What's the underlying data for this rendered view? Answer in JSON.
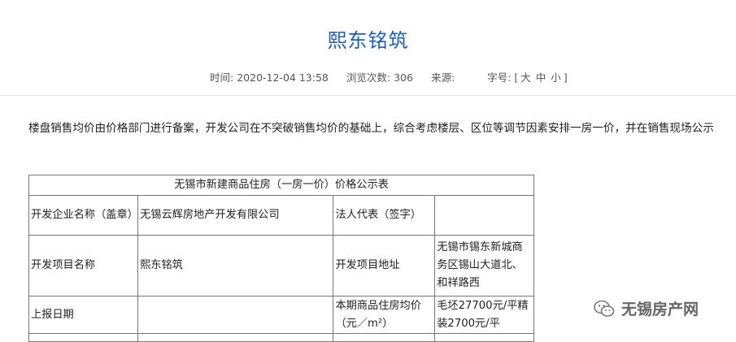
{
  "article": {
    "title": "熙东铭筑",
    "meta": {
      "time_label": "时间:",
      "time_value": "2020-12-04 13:58",
      "views_label": "浏览次数:",
      "views_value": "306",
      "source_label": "来源:",
      "font_label": "字号:",
      "font_open": "[",
      "font_large": "大",
      "font_medium": "中",
      "font_small": "小",
      "font_close": "]"
    },
    "intro": "楼盘销售均价由价格部门进行备案，开发公司在不突破销售均价的基础上，综合考虑楼层、区位等调节因素安排一房一价，并在销售现场公示"
  },
  "table": {
    "caption": "无锡市新建商品住房（一房一价）价格公示表",
    "rows": [
      [
        "开发企业名称（盖章）",
        "无锡云辉房地产开发有限公司",
        "法人代表（签字）",
        ""
      ],
      [
        "开发项目名称",
        "熙东铭筑",
        "开发项目地址",
        "无锡市锡东新城商务区锡山大道北、和祥路西"
      ],
      [
        "上报日期",
        "",
        "本期商品住房均价（元／m²）",
        "毛坯27700元/平精装2700元/平"
      ]
    ]
  },
  "watermark": {
    "text": "无锡房产网",
    "icon": "wechat-icon"
  }
}
